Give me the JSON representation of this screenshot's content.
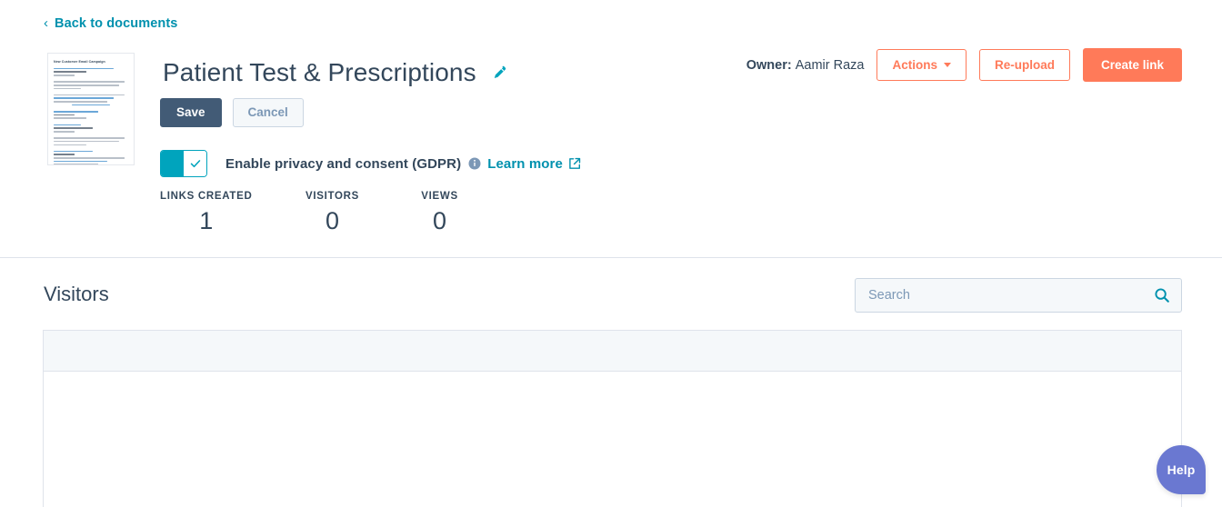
{
  "nav": {
    "back_label": "Back to documents",
    "back_icon": "chevron-left-icon"
  },
  "document": {
    "title": "Patient Test & Prescriptions",
    "edit_icon": "pencil-icon",
    "thumbnail_title": "New Customer Email Campaign"
  },
  "actions": {
    "save_label": "Save",
    "cancel_label": "Cancel",
    "owner_prefix": "Owner:",
    "owner_name": "Aamir Raza",
    "actions_label": "Actions",
    "actions_caret_icon": "caret-down-icon",
    "reupload_label": "Re-upload",
    "create_link_label": "Create link"
  },
  "gdpr": {
    "toggle_state": "on",
    "toggle_check_icon": "check-icon",
    "label": "Enable privacy and consent (GDPR)",
    "info_icon": "info-circle-icon",
    "learn_more_label": "Learn more",
    "external_icon": "external-link-icon"
  },
  "stats": [
    {
      "label": "LINKS CREATED",
      "value": "1"
    },
    {
      "label": "VISITORS",
      "value": "0"
    },
    {
      "label": "VIEWS",
      "value": "0"
    }
  ],
  "visitors": {
    "heading": "Visitors",
    "search_placeholder": "Search",
    "search_value": "",
    "search_icon": "search-icon",
    "table_rows": []
  },
  "help": {
    "label": "Help"
  },
  "colors": {
    "link_teal": "#0091ae",
    "toggle_teal": "#00a4bd",
    "brand_orange": "#ff7a59",
    "dark_slate": "#33475b",
    "save_navy": "#425b76",
    "help_purple": "#6a78d1",
    "border_gray": "#dfe3eb",
    "table_head_bg": "#f5f8fa"
  }
}
